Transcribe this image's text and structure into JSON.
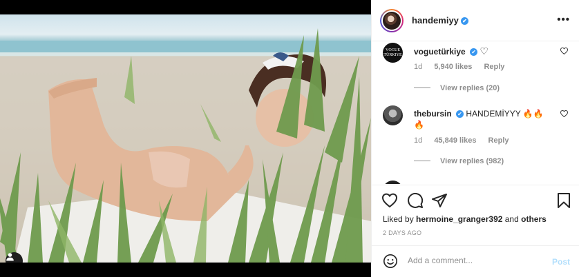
{
  "post": {
    "username": "handemiyy",
    "more_glyph": "•••",
    "verified_glyph": "✔"
  },
  "comments": [
    {
      "username": "voguetürkiye",
      "text": "♡",
      "time": "1d",
      "likes": "5,940 likes",
      "reply": "Reply",
      "view_replies": "View replies (20)",
      "avatar_text": "VOGUE TÜRKIYE"
    },
    {
      "username": "thebursin",
      "text": "HANDEMİYYY 🔥🔥 🔥",
      "time": "1d",
      "likes": "45,849 likes",
      "reply": "Reply",
      "view_replies": "View replies (982)"
    }
  ],
  "actions": {
    "liked_prefix": "Liked by ",
    "liked_user": "hermoine_granger392",
    "liked_and": " and ",
    "liked_others": "others",
    "date": "2 DAYS AGO"
  },
  "composer": {
    "placeholder": "Add a comment...",
    "post_label": "Post"
  },
  "icons": {
    "heart": "heart-icon",
    "comment": "comment-icon",
    "share": "paper-plane-icon",
    "save": "bookmark-icon",
    "emoji": "emoji-icon",
    "user_tag": "user-icon"
  },
  "colors": {
    "verified": "#3897f0",
    "post_disabled": "#b2dffc",
    "meta_gray": "#8e8e8e"
  }
}
